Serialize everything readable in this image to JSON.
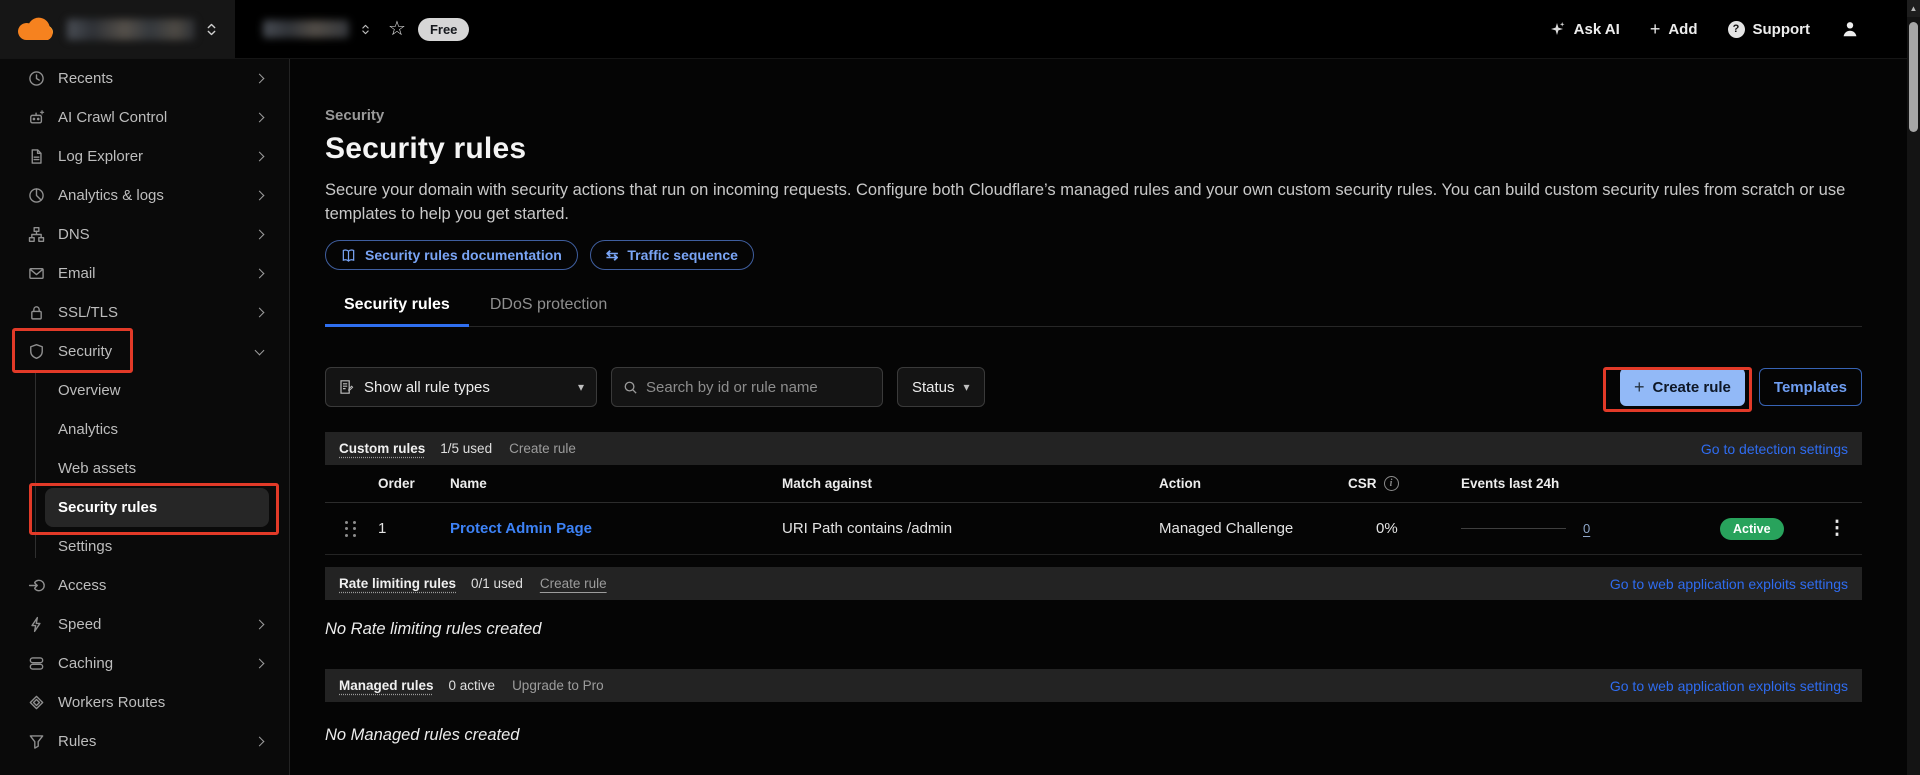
{
  "topbar": {
    "free_badge": "Free",
    "ask_ai_label": "Ask AI",
    "add_label": "Add",
    "support_label": "Support"
  },
  "icons": {
    "star": "☆",
    "traffic_arrows": "⇆",
    "caret_down": "▾",
    "kebab": "⋮",
    "plus": "+",
    "question": "?",
    "info": "i",
    "scroll_up": "▲"
  },
  "sidebar": {
    "items": [
      {
        "label": "Recents",
        "icon": "clock-icon",
        "chevron": "right"
      },
      {
        "label": "AI Crawl Control",
        "icon": "robot-icon",
        "chevron": "right"
      },
      {
        "label": "Log Explorer",
        "icon": "log-file-icon",
        "chevron": "right"
      },
      {
        "label": "Analytics & logs",
        "icon": "pie-chart-icon",
        "chevron": "right"
      },
      {
        "label": "DNS",
        "icon": "dns-tree-icon",
        "chevron": "right"
      },
      {
        "label": "Email",
        "icon": "envelope-icon",
        "chevron": "right"
      },
      {
        "label": "SSL/TLS",
        "icon": "padlock-icon",
        "chevron": "right"
      },
      {
        "label": "Security",
        "icon": "shield-icon",
        "chevron": "down"
      },
      {
        "label": "Access",
        "icon": "access-arrow-icon",
        "chevron": "none"
      },
      {
        "label": "Speed",
        "icon": "lightning-icon",
        "chevron": "right"
      },
      {
        "label": "Caching",
        "icon": "layers-icon",
        "chevron": "right"
      },
      {
        "label": "Workers Routes",
        "icon": "code-diamond-icon",
        "chevron": "none"
      },
      {
        "label": "Rules",
        "icon": "funnel-icon",
        "chevron": "right"
      }
    ],
    "security_subitems": [
      {
        "label": "Overview",
        "active": false
      },
      {
        "label": "Analytics",
        "active": false
      },
      {
        "label": "Web assets",
        "active": false
      },
      {
        "label": "Security rules",
        "active": true
      },
      {
        "label": "Settings",
        "active": false
      }
    ]
  },
  "page": {
    "breadcrumb": "Security",
    "title": "Security rules",
    "description": "Secure your domain with security actions that run on incoming requests. Configure both Cloudflare’s managed rules and your own custom security rules. You can build custom security rules from scratch or use templates to help you get started.",
    "doc_button": "Security rules documentation",
    "traffic_button": "Traffic sequence",
    "tabs": [
      {
        "label": "Security rules",
        "active": true
      },
      {
        "label": "DDoS protection",
        "active": false
      }
    ]
  },
  "toolbar": {
    "rule_type_filter": "Show all rule types",
    "search_placeholder": "Search by id or rule name",
    "status_filter": "Status",
    "create_rule_label": "Create rule",
    "templates_label": "Templates"
  },
  "custom_rules": {
    "title": "Custom rules",
    "usage": "1/5 used",
    "create_link": "Create rule",
    "settings_link": "Go to detection settings",
    "columns": {
      "order": "Order",
      "name": "Name",
      "match": "Match against",
      "action": "Action",
      "csr": "CSR",
      "events": "Events last 24h"
    },
    "rows": [
      {
        "order": "1",
        "name": "Protect Admin Page",
        "match": "URI Path contains /admin",
        "action": "Managed Challenge",
        "csr": "0%",
        "events": "0",
        "status": "Active"
      }
    ]
  },
  "rate_limiting": {
    "title": "Rate limiting rules",
    "usage": "0/1 used",
    "create_link": "Create rule",
    "settings_link": "Go to web application exploits settings",
    "empty": "No Rate limiting rules created"
  },
  "managed_rules": {
    "title": "Managed rules",
    "usage": "0 active",
    "upgrade_link": "Upgrade to Pro",
    "settings_link": "Go to web application exploits settings",
    "empty": "No Managed rules created"
  },
  "colors": {
    "brand_orange": "#f6821f",
    "brand_orange_light": "#fbad41",
    "accent_blue": "#2f6cf0",
    "link_blue": "#3d82f6",
    "primary_button_blue": "#92b9f7",
    "active_green": "#28a35c",
    "annotation_red": "#e23a28"
  }
}
